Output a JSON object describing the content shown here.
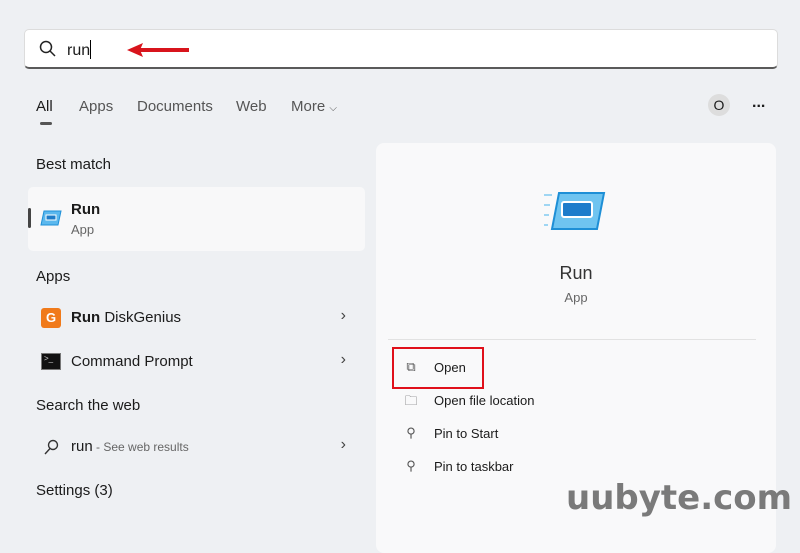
{
  "search": {
    "value": "run",
    "icon": "search-icon"
  },
  "tabs": [
    {
      "label": "All",
      "active": true
    },
    {
      "label": "Apps"
    },
    {
      "label": "Documents"
    },
    {
      "label": "Web"
    },
    {
      "label": "More"
    }
  ],
  "profile_initial": "O",
  "more_options": "...",
  "best_match": {
    "heading": "Best match",
    "title": "Run",
    "subtitle": "App"
  },
  "apps": {
    "heading": "Apps",
    "items": [
      {
        "bold": "Run",
        "rest": " DiskGenius"
      },
      {
        "bold": "",
        "rest": "Command Prompt"
      }
    ]
  },
  "web": {
    "heading": "Search the web",
    "query": "run",
    "suffix": " - See web results"
  },
  "settings": {
    "heading": "Settings (3)"
  },
  "detail": {
    "title": "Run",
    "subtitle": "App",
    "actions": [
      {
        "label": "Open",
        "icon": "open-external-icon",
        "highlighted": true
      },
      {
        "label": "Open file location",
        "icon": "folder-icon"
      },
      {
        "label": "Pin to Start",
        "icon": "pin-icon"
      },
      {
        "label": "Pin to taskbar",
        "icon": "pin-icon"
      }
    ]
  },
  "watermark": "uubyte.com",
  "colors": {
    "highlight": "#e0101a",
    "accent": "#1e90d8"
  }
}
